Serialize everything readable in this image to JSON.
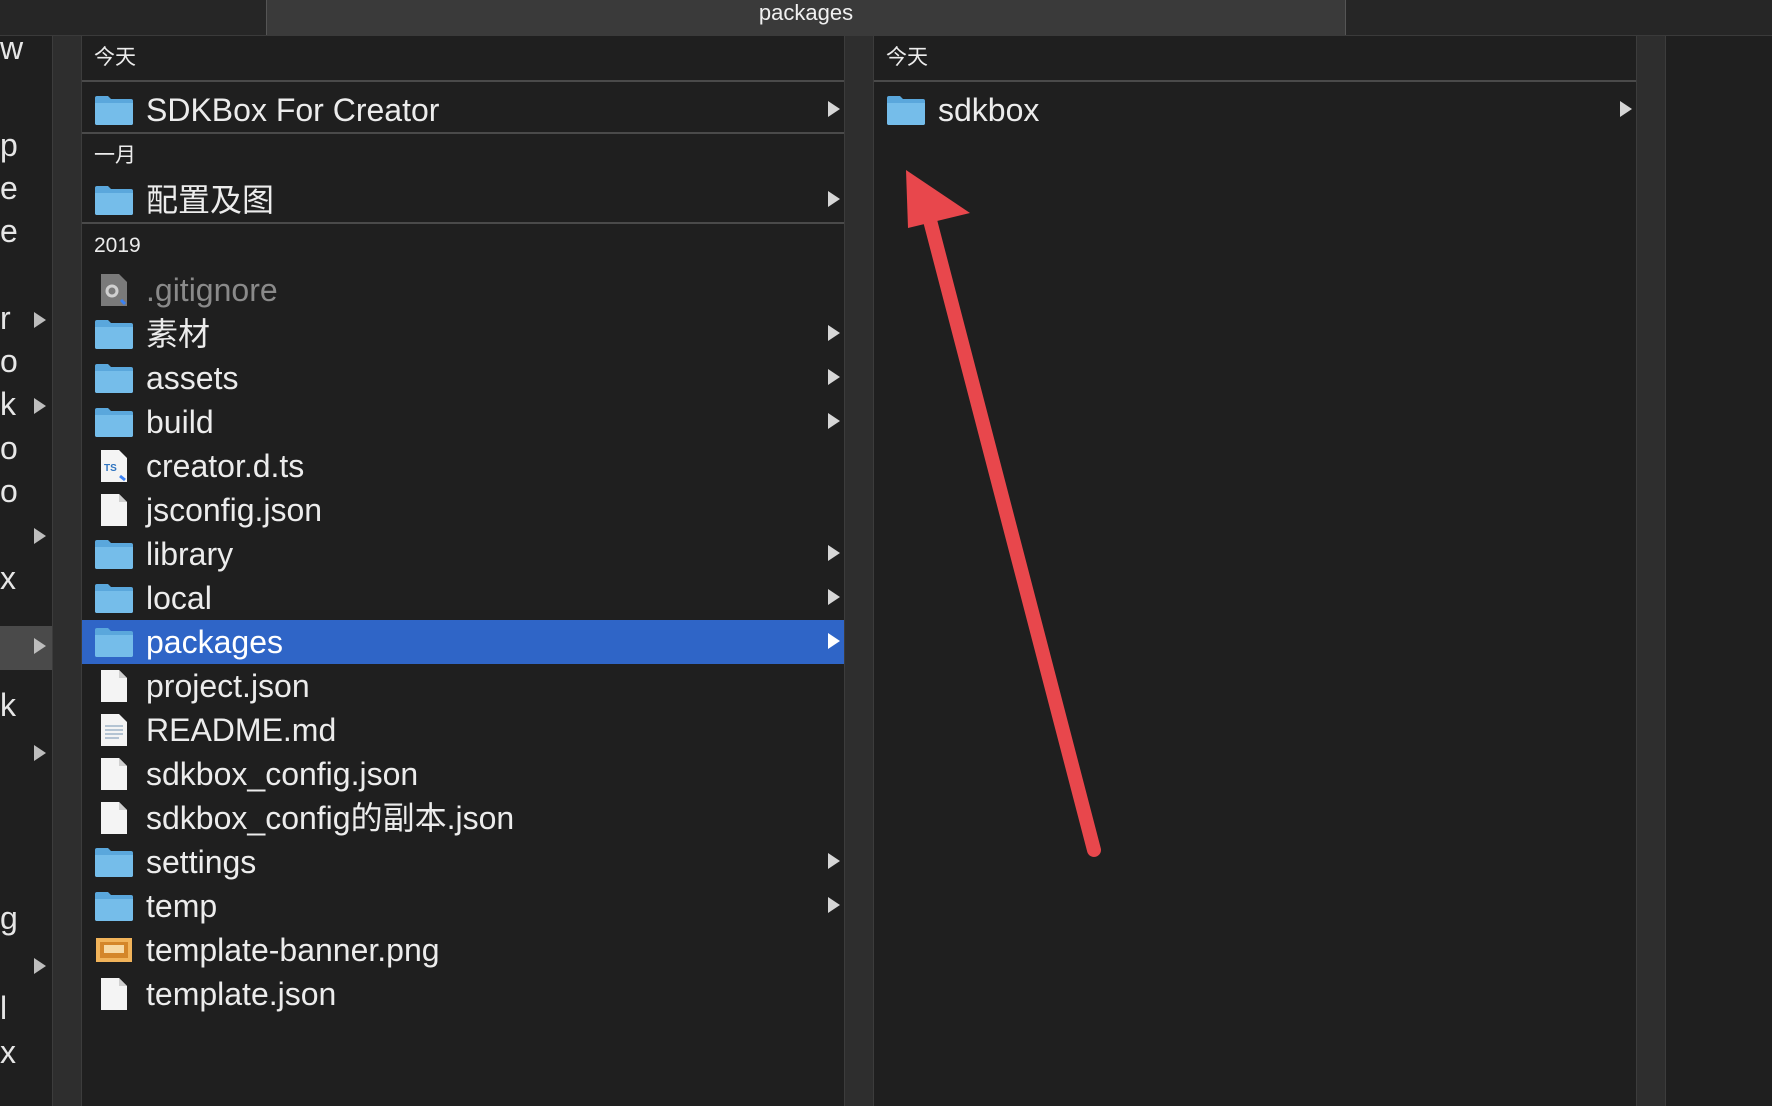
{
  "tab": {
    "title": "packages"
  },
  "column1": {
    "sections": [
      {
        "label": "今天",
        "items": [
          {
            "name": "SDKBox For Creator",
            "icon": "folder-icon",
            "chevron": true
          }
        ]
      },
      {
        "label": "一月",
        "items": [
          {
            "name": "配置及图",
            "icon": "folder-icon",
            "chevron": true
          }
        ]
      },
      {
        "label": "2019",
        "items": [
          {
            "name": ".gitignore",
            "icon": "gear-file-icon",
            "chevron": false,
            "dim": true
          },
          {
            "name": "素材",
            "icon": "folder-icon",
            "chevron": true
          },
          {
            "name": "assets",
            "icon": "folder-icon",
            "chevron": true
          },
          {
            "name": "build",
            "icon": "folder-icon",
            "chevron": true
          },
          {
            "name": "creator.d.ts",
            "icon": "ts-file-icon",
            "chevron": false
          },
          {
            "name": "jsconfig.json",
            "icon": "file-icon",
            "chevron": false
          },
          {
            "name": "library",
            "icon": "folder-icon",
            "chevron": true
          },
          {
            "name": "local",
            "icon": "folder-icon",
            "chevron": true
          },
          {
            "name": "packages",
            "icon": "folder-icon",
            "chevron": true,
            "selected": true
          },
          {
            "name": "project.json",
            "icon": "file-icon",
            "chevron": false
          },
          {
            "name": "README.md",
            "icon": "text-file-icon",
            "chevron": false
          },
          {
            "name": "sdkbox_config.json",
            "icon": "file-icon",
            "chevron": false
          },
          {
            "name": "sdkbox_config的副本.json",
            "icon": "file-icon",
            "chevron": false
          },
          {
            "name": "settings",
            "icon": "folder-icon",
            "chevron": true
          },
          {
            "name": "temp",
            "icon": "folder-icon",
            "chevron": true
          },
          {
            "name": "template-banner.png",
            "icon": "image-file-icon",
            "chevron": false
          },
          {
            "name": "template.json",
            "icon": "file-icon",
            "chevron": false
          }
        ]
      }
    ]
  },
  "column2": {
    "sections": [
      {
        "label": "今天",
        "items": [
          {
            "name": "sdkbox",
            "icon": "folder-icon",
            "chevron": true
          }
        ]
      }
    ]
  },
  "column0_partial": [
    {
      "text": "w",
      "chev": false
    },
    {
      "text": "p",
      "chev": false
    },
    {
      "text": "e",
      "chev": false
    },
    {
      "text": "e",
      "chev": false
    },
    {
      "text": "r",
      "chev": true
    },
    {
      "text": "o",
      "chev": false
    },
    {
      "text": "k",
      "chev": true
    },
    {
      "text": "o",
      "chev": false
    },
    {
      "text": "o",
      "chev": false
    },
    {
      "text": "",
      "chev": true
    },
    {
      "text": "x",
      "chev": false
    },
    {
      "text": "",
      "chev": true,
      "selected": true
    },
    {
      "text": "k",
      "chev": false
    },
    {
      "text": "",
      "chev": true
    },
    {
      "text": "g",
      "chev": false
    },
    {
      "text": "",
      "chev": true
    },
    {
      "text": "l",
      "chev": false
    },
    {
      "text": "x",
      "chev": false
    }
  ],
  "annotation": {
    "color": "#e8474c"
  }
}
